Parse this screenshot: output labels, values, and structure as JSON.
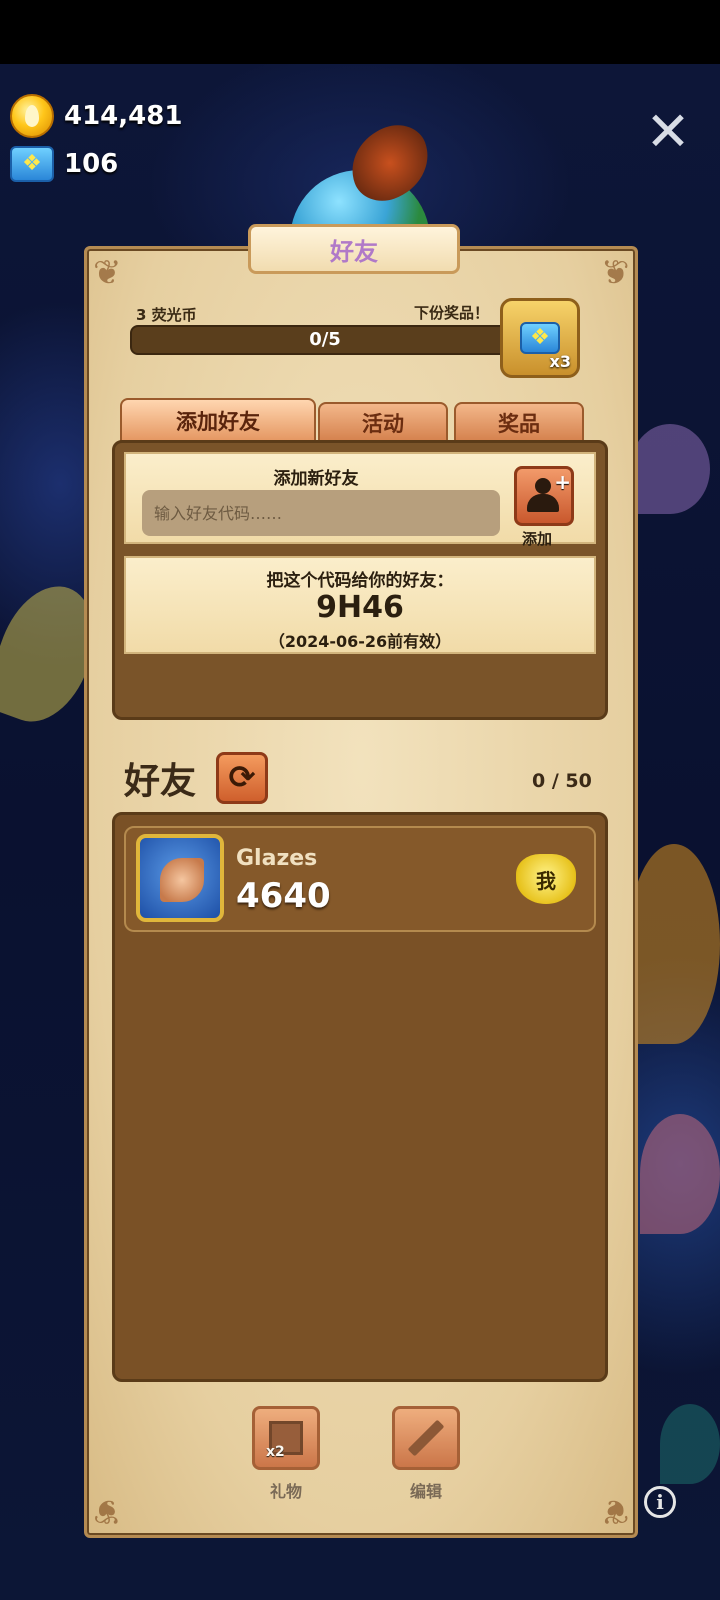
{
  "currency": {
    "coins": "414,481",
    "gems": "106"
  },
  "header": {
    "title": "好友"
  },
  "progress": {
    "left_label": "3 荧光币",
    "right_label": "下份奖品！",
    "value_text": "0/5",
    "fraction": 0,
    "reward_multiplier": "x3"
  },
  "tabs": [
    "添加好友",
    "活动",
    "奖品"
  ],
  "add_friend": {
    "title": "添加新好友",
    "placeholder": "输入好友代码……",
    "add_label": "添加"
  },
  "share_code": {
    "prompt": "把这个代码给你的好友：",
    "code": "9H46",
    "expiry": "（2024-06-26前有效）"
  },
  "friends": {
    "title": "好友",
    "count": "0 / 50",
    "list": [
      {
        "name": "Glazes",
        "score": "4640",
        "badge": "我"
      }
    ]
  },
  "bottom": {
    "gift_label": "礼物",
    "gift_multiplier": "x2",
    "edit_label": "编辑"
  },
  "icons": {
    "close": "close-icon",
    "info": "info-icon",
    "refresh": "refresh-icon",
    "add_friend": "add-person-icon",
    "gift": "gift-icon",
    "edit": "pencil-icon"
  },
  "colors": {
    "panel": "#e6cfa0",
    "tab": "#d4804c",
    "dark_box": "#7a5429",
    "background": "#0b1230"
  }
}
